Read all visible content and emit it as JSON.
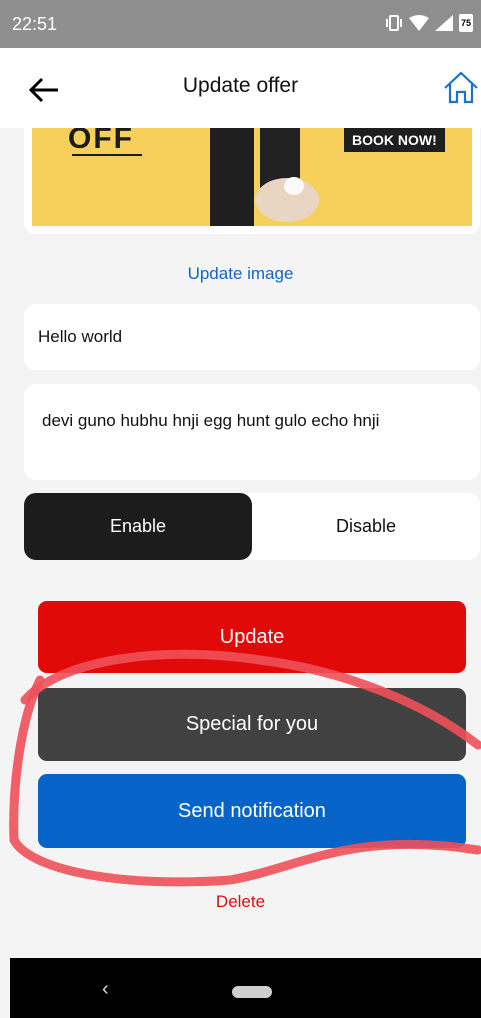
{
  "status_bar": {
    "time": "22:51",
    "battery": "75"
  },
  "app_bar": {
    "title": "Update offer",
    "back_icon": "arrow-left-icon",
    "home_icon": "home-icon"
  },
  "banner": {
    "text": "OFF",
    "tag": "BOOK NOW!"
  },
  "update_image_label": "Update image",
  "title_field": {
    "value": "Hello world"
  },
  "description_field": {
    "value": "devi guno hubhu hnji egg hunt gulo echo hnji"
  },
  "toggle": {
    "enable_label": "Enable",
    "disable_label": "Disable",
    "selected": "Enable"
  },
  "buttons": {
    "update": "Update",
    "special": "Special for you",
    "notify": "Send notification"
  },
  "delete_label": "Delete",
  "colors": {
    "accent_red": "#e20909",
    "dark_gray": "#414141",
    "blue": "#0664c8",
    "link_blue": "#1565c0",
    "scribble": "#f0505a"
  }
}
